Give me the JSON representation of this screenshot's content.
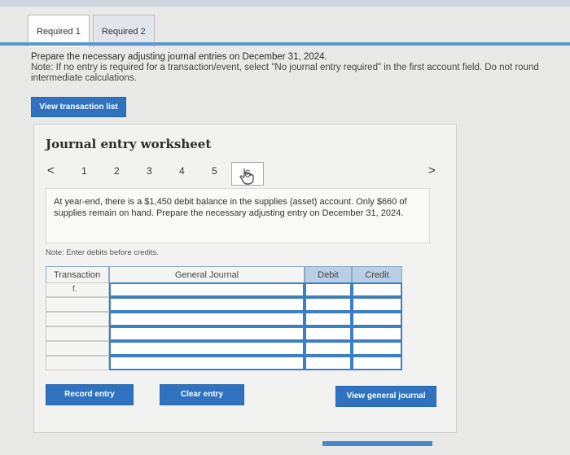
{
  "tabs": [
    {
      "label": "Required 1"
    },
    {
      "label": "Required 2"
    }
  ],
  "instructions": {
    "line1": "Prepare the necessary adjusting journal entries on December 31, 2024.",
    "line2": "Note: If no entry is required for a transaction/event, select \"No journal entry required\" in the first account field. Do not round",
    "line3": "intermediate calculations."
  },
  "view_transaction_list": "View transaction list",
  "worksheet": {
    "title": "Journal entry worksheet",
    "prev": "<",
    "next": ">",
    "pages": [
      "1",
      "2",
      "3",
      "4",
      "5"
    ],
    "current_page": "6",
    "question": "At year-end, there is a $1,450 debit balance in the supplies (asset) account. Only $660 of supplies remain on hand. Prepare the necessary adjusting entry on December 31, 2024.",
    "note": "Note: Enter debits before credits."
  },
  "table": {
    "headers": {
      "transaction": "Transaction",
      "general_journal": "General Journal",
      "debit": "Debit",
      "credit": "Credit"
    },
    "rows": [
      {
        "transaction": "f."
      },
      {
        "transaction": ""
      },
      {
        "transaction": ""
      },
      {
        "transaction": ""
      },
      {
        "transaction": ""
      },
      {
        "transaction": ""
      }
    ]
  },
  "buttons": {
    "record_entry": "Record entry",
    "clear_entry": "Clear entry",
    "view_general_journal": "View general journal"
  }
}
